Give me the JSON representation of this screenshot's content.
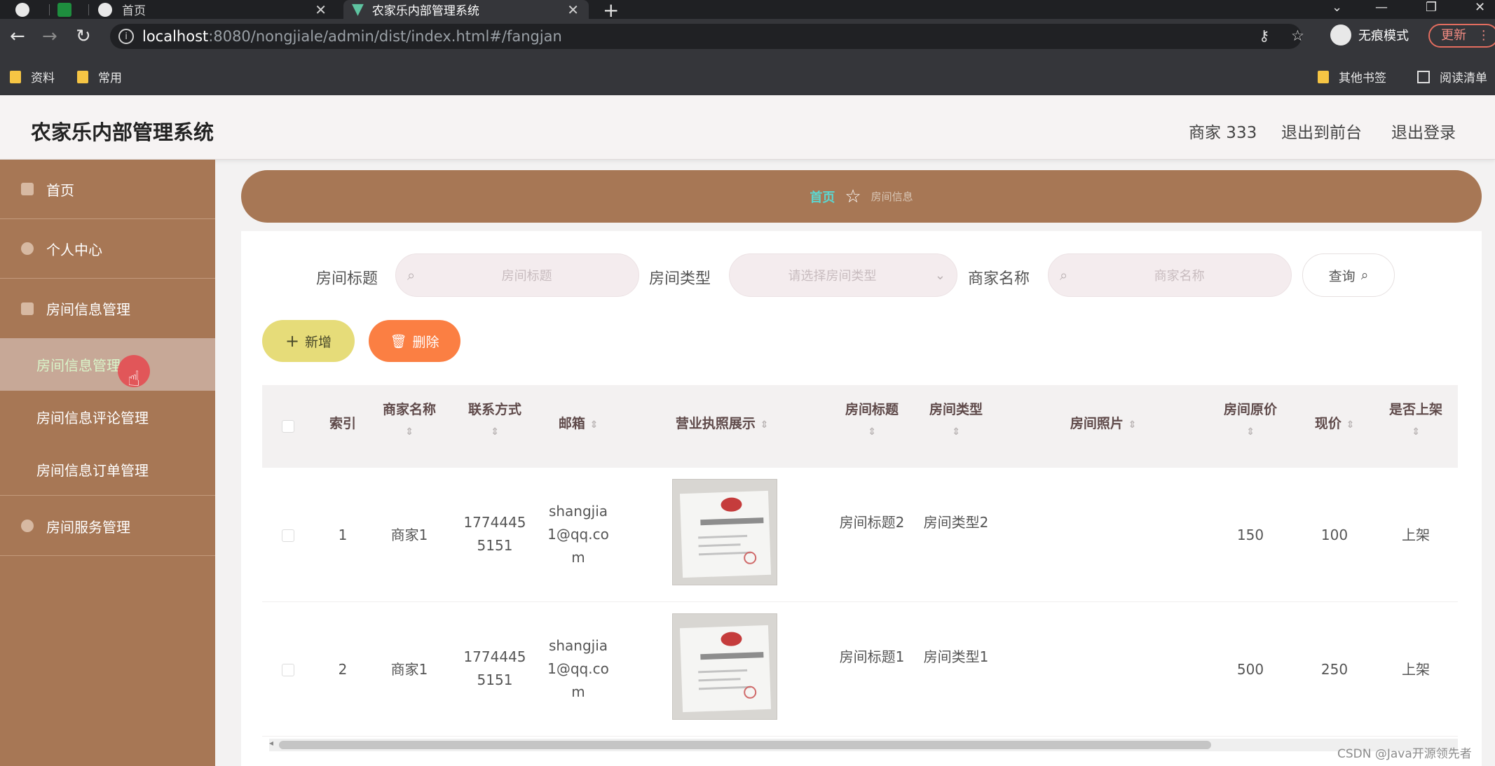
{
  "browser": {
    "tabs": [
      {
        "title": "首页"
      },
      {
        "title": "农家乐内部管理系统"
      }
    ],
    "url_host": "localhost",
    "url_path": ":8080/nongjiale/admin/dist/index.html#/fangjan",
    "incognito_label": "无痕模式",
    "update_label": "更新",
    "bookmarks": [
      {
        "label": "资料"
      },
      {
        "label": "常用"
      },
      {
        "label": "其他书签"
      },
      {
        "label": "阅读清单"
      }
    ]
  },
  "header": {
    "title": "农家乐内部管理系统",
    "user": "商家 333",
    "front_link": "退出到前台",
    "logout_link": "退出登录"
  },
  "sidebar": {
    "items": [
      {
        "label": "首页",
        "icon": "home-icon"
      },
      {
        "label": "个人中心",
        "icon": "user-icon"
      },
      {
        "label": "房间信息管理",
        "icon": "document-icon"
      },
      {
        "label": "房间服务管理",
        "icon": "service-icon"
      }
    ],
    "sub_items": [
      {
        "label": "房间信息管理"
      },
      {
        "label": "房间信息评论管理"
      },
      {
        "label": "房间信息订单管理"
      }
    ]
  },
  "breadcrumb": {
    "home": "首页",
    "current": "房间信息"
  },
  "search": {
    "fields": [
      {
        "label": "房间标题",
        "placeholder": "房间标题"
      },
      {
        "label": "房间类型",
        "placeholder": "请选择房间类型"
      },
      {
        "label": "商家名称",
        "placeholder": "商家名称"
      }
    ],
    "query_label": "查询"
  },
  "actions": {
    "add_label": "新增",
    "delete_label": "删除"
  },
  "table": {
    "columns": [
      "索引",
      "商家名称",
      "联系方式",
      "邮箱",
      "营业执照展示",
      "房间标题",
      "房间类型",
      "房间照片",
      "房间原价",
      "现价",
      "是否上架"
    ],
    "rows": [
      {
        "index": "1",
        "merchant": "商家1",
        "phone": "17744455151",
        "email": "shangjia1@qq.com",
        "title": "房间标题2",
        "type": "房间类型2",
        "original_price": "150",
        "price": "100",
        "status": "上架"
      },
      {
        "index": "2",
        "merchant": "商家1",
        "phone": "17744455151",
        "email": "shangjia1@qq.com",
        "title": "房间标题1",
        "type": "房间类型1",
        "original_price": "500",
        "price": "250",
        "status": "上架"
      }
    ]
  },
  "watermark": "CSDN @Java开源领先者",
  "colors": {
    "sidebar": "#a77755",
    "add_button": "#e6dc79",
    "delete_button": "#fb7f43",
    "breadcrumb_home": "#5bd7d1"
  }
}
